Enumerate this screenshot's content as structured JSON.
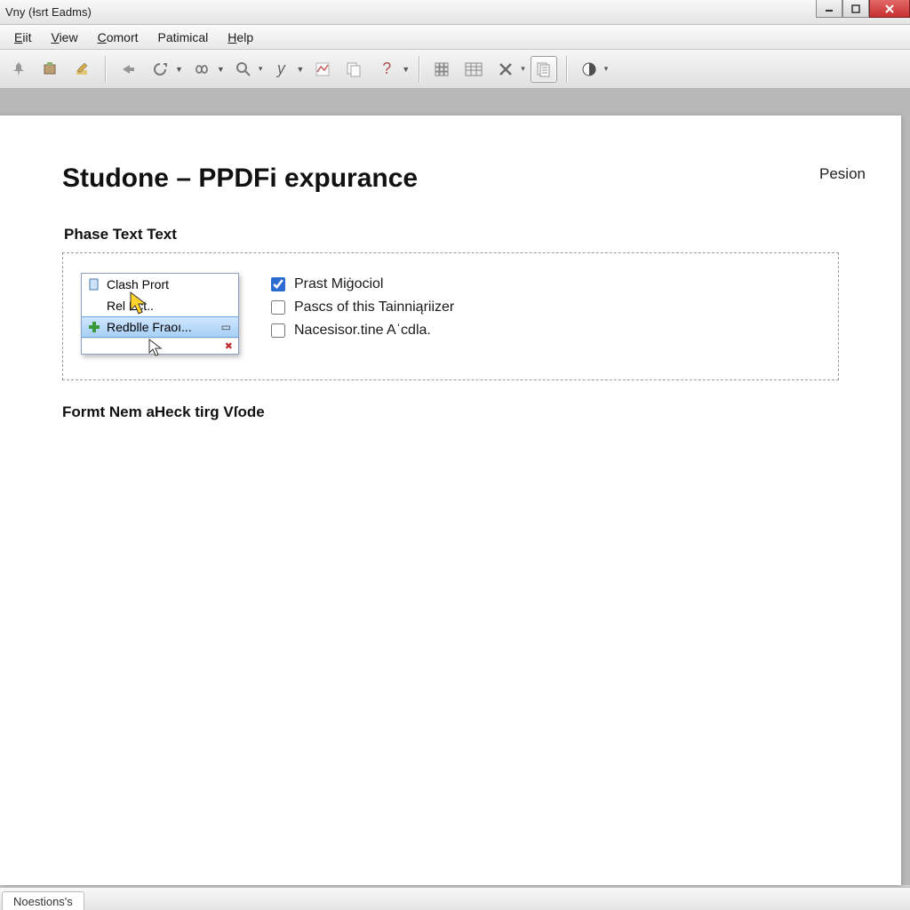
{
  "window": {
    "title": "Vny (Ɨsrt Eadms)"
  },
  "menu": {
    "items": [
      {
        "label": "Eiit",
        "u": "E"
      },
      {
        "label": "View",
        "u": "V"
      },
      {
        "label": "Comort",
        "u": "C"
      },
      {
        "label": "Patimical",
        "u": ""
      },
      {
        "label": "Help",
        "u": "H"
      }
    ]
  },
  "page": {
    "corner": "Pesion",
    "title": "Studone – PPDFi expurance",
    "section1": "Phase Text Text",
    "section2": "Formt Nem aHeck tirg Vſode",
    "contextMenu": {
      "items": [
        {
          "icon": "doc",
          "label": "Clash Prort"
        },
        {
          "icon": "",
          "label": "Rel   Ect.."
        },
        {
          "icon": "plus",
          "label": "Redblle Fraoı...",
          "selected": true,
          "trail": "▭"
        }
      ],
      "footer": "✖"
    },
    "checks": [
      {
        "label": "Prast Miġociol",
        "checked": true
      },
      {
        "label": "Pascs of this Tainniąriizer",
        "checked": false
      },
      {
        "label": "Nacesisor.tine Aˈcdla.",
        "checked": false
      }
    ]
  },
  "status": {
    "tab": "Noestions's"
  }
}
